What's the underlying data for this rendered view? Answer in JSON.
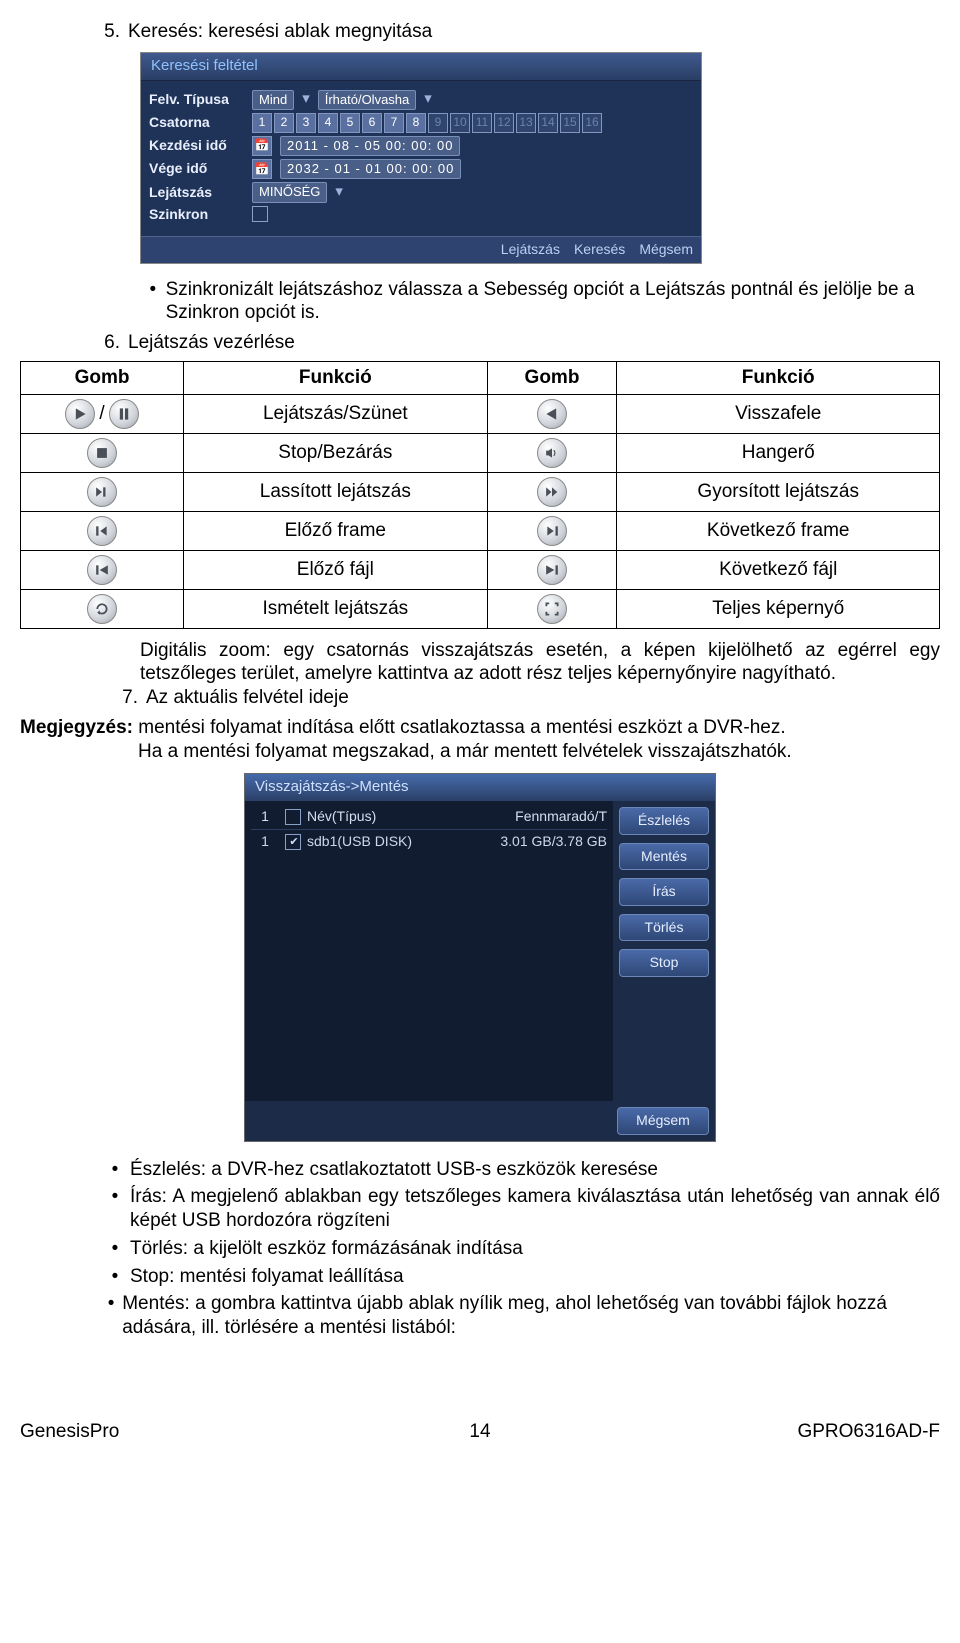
{
  "section5": {
    "num": "5.",
    "title": "Keresés: keresési ablak megnyitása"
  },
  "ui1": {
    "title": "Keresési feltétel",
    "rows": {
      "type_label": "Felv. Típusa",
      "type_val1": "Mind",
      "type_val2": "Írható/Olvasha",
      "channel_label": "Csatorna",
      "start_label": "Kezdési idő",
      "start_val": "2011 - 08 - 05  00: 00: 00",
      "end_label": "Vége idő",
      "end_val": "2032 - 01 - 01  00: 00: 00",
      "play_label": "Lejátszás",
      "play_val": "MINŐSÉG",
      "sync_label": "Szinkron"
    },
    "footer": {
      "b1": "Lejátszás",
      "b2": "Keresés",
      "b3": "Mégsem"
    }
  },
  "after_ui1_bullet": "Szinkronizált lejátszáshoz válassza a Sebesség opciót a Lejátszás pontnál és jelölje be a Szinkron opciót is.",
  "section6": {
    "num": "6.",
    "title": "Lejátszás vezérlése"
  },
  "table": {
    "h1": "Gomb",
    "h2": "Funkció",
    "h3": "Gomb",
    "h4": "Funkció",
    "r1c2": "Lejátszás/Szünet",
    "r1c4": "Visszafele",
    "r2c2": "Stop/Bezárás",
    "r2c4": "Hangerő",
    "r3c2": "Lassított lejátszás",
    "r3c4": "Gyorsított lejátszás",
    "r4c2": "Előző frame",
    "r4c4": "Következő frame",
    "r5c2": "Előző fájl",
    "r5c4": "Következő fájl",
    "r6c2": "Ismételt lejátszás",
    "r6c4": "Teljes képernyő"
  },
  "after_table": {
    "zoom": "Digitális zoom: egy csatornás visszajátszás esetén, a képen kijelölhető az egérrel egy tetszőleges terület, amelyre kattintva az adott rész teljes képernyőnyire nagyítható.",
    "seven_num": "7.",
    "seven_text": "Az aktuális felvétel ideje"
  },
  "note": {
    "label": "Megjegyzés:",
    "line1": "mentési folyamat indítása előtt csatlakoztassa a mentési eszközt a DVR-hez.",
    "line2": "Ha a mentési folyamat megszakad, a már mentett felvételek visszajátszhatók."
  },
  "ui2": {
    "title": "Visszajátszás->Mentés",
    "header": {
      "c1": "1",
      "c3": "Név(Típus)",
      "c4": "Fennmaradó/T"
    },
    "row": {
      "c1": "1",
      "c3": "sdb1(USB DISK)",
      "c4": "3.01 GB/3.78 GB"
    },
    "buttons": {
      "b1": "Észlelés",
      "b2": "Mentés",
      "b3": "Írás",
      "b4": "Törlés",
      "b5": "Stop"
    },
    "cancel": "Mégsem"
  },
  "bottom_bullets": {
    "b1": "Észlelés: a DVR-hez csatlakoztatott USB-s eszközök keresése",
    "b2": "Írás: A megjelenő ablakban egy tetszőleges kamera kiválasztása után lehetőség van annak élő képét USB hordozóra rögzíteni",
    "b3": "Törlés: a kijelölt eszköz formázásának indítása",
    "b4": "Stop: mentési folyamat leállítása",
    "b5": "Mentés: a gombra kattintva újabb ablak nyílik meg, ahol lehetőség van további fájlok hozzá adására, ill. törlésére a mentési listából:"
  },
  "footer": {
    "left": "GenesisPro",
    "center": "14",
    "right": "GPRO6316AD-F"
  }
}
